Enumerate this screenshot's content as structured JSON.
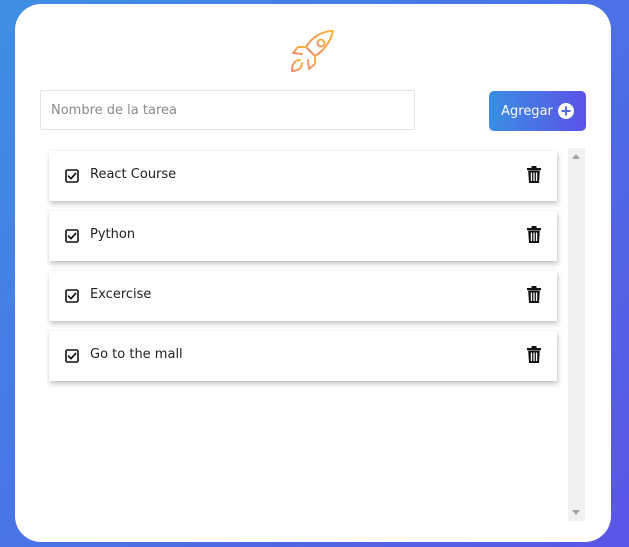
{
  "app": {
    "logo_icon": "rocket-icon",
    "accent_start": "#3a8ee2",
    "accent_end": "#5b52e8",
    "logo_color": "#f4a36a"
  },
  "form": {
    "task_placeholder": "Nombre de la tarea",
    "task_value": "",
    "add_label": "Agregar",
    "add_icon": "plus-circle-icon"
  },
  "tasks": [
    {
      "label": "React Course",
      "checked": true
    },
    {
      "label": "Python",
      "checked": true
    },
    {
      "label": "Excercise",
      "checked": true
    },
    {
      "label": "Go to the mall",
      "checked": true
    }
  ]
}
